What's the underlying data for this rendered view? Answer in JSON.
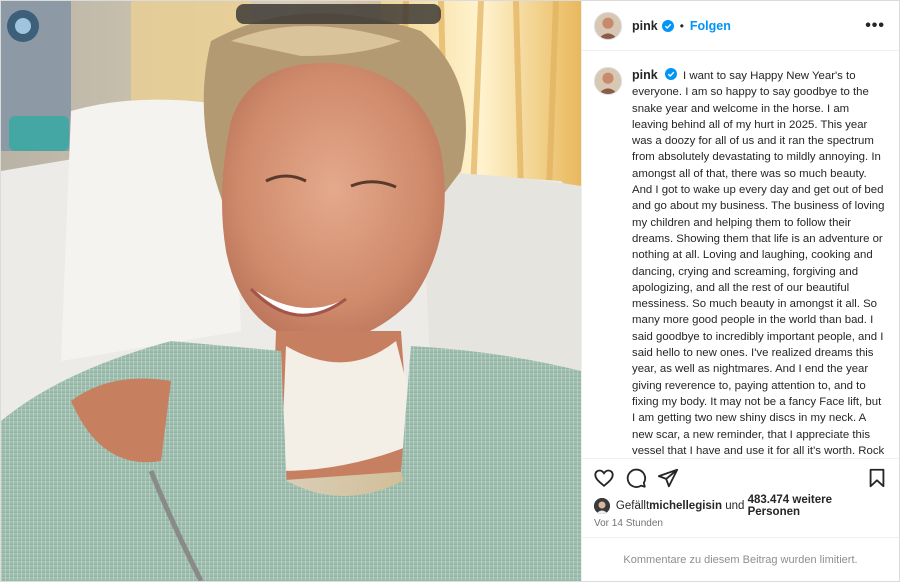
{
  "header": {
    "username": "pink",
    "separator": "•",
    "follow_label": "Folgen",
    "more_label": "•••",
    "avatar_icon": "profile-avatar",
    "verified_icon": "verified-badge-icon",
    "verified_color": "#0095f6"
  },
  "caption": {
    "username": "pink",
    "text": "I want to say Happy New Year's to everyone. I am so happy to say goodbye to the snake year and welcome in the horse. I am leaving behind all of my hurt in 2025. This year was a doozy for all of us and it ran the spectrum from absolutely devastating to mildly annoying. In amongst all of that, there was so much beauty. And I got to wake up every day and get out of bed and go about my business. The business of loving my children and helping them to follow their dreams. Showing them that life is an adventure or nothing at all. Loving and laughing, cooking and dancing, crying and screaming, forgiving and apologizing, and all the rest of our beautiful messiness. So much beauty in amongst it all. So many more good people in the world than bad. I said goodbye to incredibly important people, and I said hello to new ones. I've realized dreams this year, as well as nightmares. And I end the year giving reverence to, paying attention to, and to fixing my body. It may not be a fancy Face lift, but I am getting two new shiny discs in my neck. A new scar, a new reminder, that I appreciate this vessel that I have and use it for all it's worth. Rock 'n' roll is a contact sport. And as I sit here by myself on New Year's Eve in a hospital room while my family is happily snowboarding- I know that 2026 is going to be better because that is the choice that I have"
  },
  "actions": {
    "like_icon": "heart-icon",
    "comment_icon": "comment-icon",
    "share_icon": "share-icon",
    "save_icon": "bookmark-icon"
  },
  "likes": {
    "prefix": "Gefällt ",
    "user": "michellegisin",
    "middle": " und ",
    "count": "483.474 weitere Personen"
  },
  "time": "Vor 14 Stunden",
  "comments_limited": "Kommentare zu diesem Beitrag wurden limitiert.",
  "colors": {
    "accent": "#0095f6",
    "text": "#262626",
    "secondary": "#737373"
  }
}
